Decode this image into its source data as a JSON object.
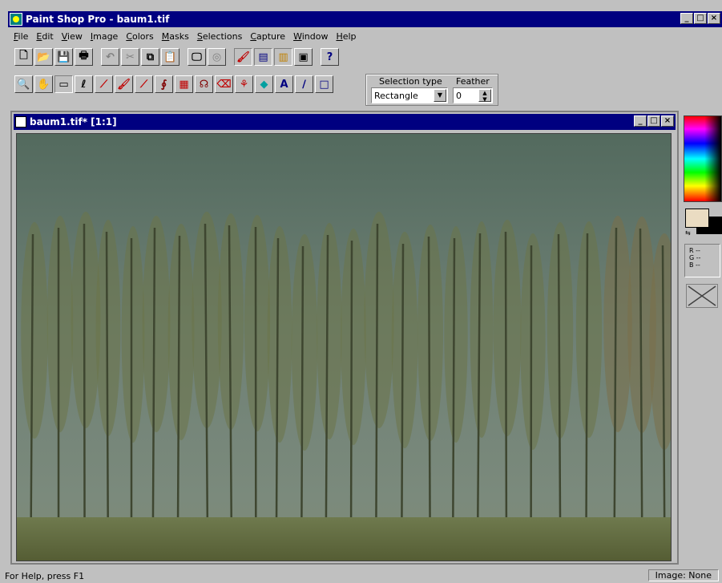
{
  "app": {
    "title": "Paint Shop Pro - baum1.tif",
    "window_buttons": {
      "minimize": "_",
      "maximize": "□",
      "close": "×"
    }
  },
  "menu": [
    "File",
    "Edit",
    "View",
    "Image",
    "Colors",
    "Masks",
    "Selections",
    "Capture",
    "Window",
    "Help"
  ],
  "toolbar_main": [
    {
      "icon": "new-file-icon",
      "glyph": "🗋"
    },
    {
      "icon": "open-file-icon",
      "glyph": "📂"
    },
    {
      "icon": "save-icon",
      "glyph": "💾"
    },
    {
      "icon": "print-icon",
      "glyph": "🖶"
    },
    {
      "icon": "undo-icon",
      "glyph": "↶"
    },
    {
      "icon": "cut-icon",
      "glyph": "✂"
    },
    {
      "icon": "copy-icon",
      "glyph": "⧉"
    },
    {
      "icon": "paste-icon",
      "glyph": "📋"
    },
    {
      "icon": "monitor-icon",
      "glyph": "🖵"
    },
    {
      "icon": "zoom-fit-icon",
      "glyph": "◎"
    },
    {
      "icon": "brush-palette-icon",
      "glyph": "🖌"
    },
    {
      "icon": "histogram-icon",
      "glyph": "▤"
    },
    {
      "icon": "color-bars-icon",
      "glyph": "▥"
    },
    {
      "icon": "image-overview-icon",
      "glyph": "▣"
    },
    {
      "icon": "context-help-icon",
      "glyph": "?"
    }
  ],
  "toolbar_tools": [
    {
      "icon": "zoom-icon",
      "glyph": "🔍"
    },
    {
      "icon": "hand-pan-icon",
      "glyph": "✋"
    },
    {
      "icon": "rectangle-select-icon",
      "glyph": "▭"
    },
    {
      "icon": "lasso-icon",
      "glyph": "ℓ"
    },
    {
      "icon": "eyedropper-icon",
      "glyph": "⟋"
    },
    {
      "icon": "paintbrush-icon",
      "glyph": "🖌"
    },
    {
      "icon": "clone-brush-icon",
      "glyph": "⟋"
    },
    {
      "icon": "airbrush-icon",
      "glyph": "∮"
    },
    {
      "icon": "color-replacer-icon",
      "glyph": "▦"
    },
    {
      "icon": "retouch-icon",
      "glyph": "☊"
    },
    {
      "icon": "eraser-icon",
      "glyph": "⌫"
    },
    {
      "icon": "picture-tube-icon",
      "glyph": "⚘"
    },
    {
      "icon": "flood-fill-icon",
      "glyph": "◆"
    },
    {
      "icon": "text-icon",
      "glyph": "A"
    },
    {
      "icon": "line-icon",
      "glyph": "∕"
    },
    {
      "icon": "shape-icon",
      "glyph": "□"
    }
  ],
  "selection": {
    "type_label": "Selection type",
    "type_value": "Rectangle",
    "feather_label": "Feather",
    "feather_value": "0"
  },
  "document": {
    "title": "baum1.tif* [1:1]"
  },
  "palette": {
    "rgb_lines": [
      "R --",
      "G --",
      "B --"
    ],
    "foreground_color": "#eadcc2",
    "background_color": "#000000"
  },
  "status": {
    "help": "For Help, press F1",
    "image": "Image: None"
  }
}
